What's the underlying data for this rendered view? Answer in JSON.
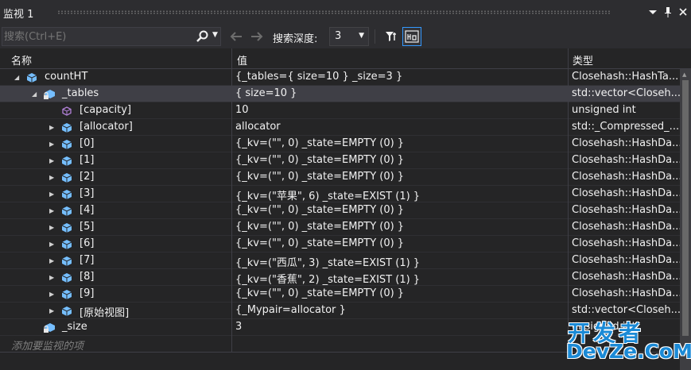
{
  "window": {
    "title": "监视 1",
    "buttons": [
      "chevron-down-icon",
      "pin-icon",
      "close-icon"
    ]
  },
  "toolbar": {
    "search_placeholder": "搜索(Ctrl+E)",
    "search_depth_label": "搜索深度:",
    "search_depth_value": "3"
  },
  "columns": {
    "name": "名称",
    "value": "值",
    "type": "类型"
  },
  "rows": [
    {
      "name": "countHT",
      "value": "{_tables={ size=10 } _size=3 }",
      "type": "Closehash::HashTa...",
      "level": 0,
      "expanded": true,
      "icon": "object-icon"
    },
    {
      "name": "_tables",
      "value": "{ size=10 }",
      "type": "std::vector<Closeh...",
      "level": 1,
      "expanded": true,
      "icon": "field-lock-icon",
      "selected": true
    },
    {
      "name": "[capacity]",
      "value": "10",
      "type": "unsigned int",
      "level": 2,
      "expanded": null,
      "icon": "property-icon"
    },
    {
      "name": "[allocator]",
      "value": "allocator",
      "type": "std::_Compressed_...",
      "level": 2,
      "expanded": false,
      "icon": "object-icon"
    },
    {
      "name": "[0]",
      "value": "{_kv=(\"\", 0) _state=EMPTY (0) }",
      "type": "Closehash::HashDa...",
      "level": 2,
      "expanded": false,
      "icon": "object-icon"
    },
    {
      "name": "[1]",
      "value": "{_kv=(\"\", 0) _state=EMPTY (0) }",
      "type": "Closehash::HashDa...",
      "level": 2,
      "expanded": false,
      "icon": "object-icon"
    },
    {
      "name": "[2]",
      "value": "{_kv=(\"\", 0) _state=EMPTY (0) }",
      "type": "Closehash::HashDa...",
      "level": 2,
      "expanded": false,
      "icon": "object-icon"
    },
    {
      "name": "[3]",
      "value": "{_kv=(\"苹果\", 6) _state=EXIST (1) }",
      "type": "Closehash::HashDa...",
      "level": 2,
      "expanded": false,
      "icon": "object-icon"
    },
    {
      "name": "[4]",
      "value": "{_kv=(\"\", 0) _state=EMPTY (0) }",
      "type": "Closehash::HashDa...",
      "level": 2,
      "expanded": false,
      "icon": "object-icon"
    },
    {
      "name": "[5]",
      "value": "{_kv=(\"\", 0) _state=EMPTY (0) }",
      "type": "Closehash::HashDa...",
      "level": 2,
      "expanded": false,
      "icon": "object-icon"
    },
    {
      "name": "[6]",
      "value": "{_kv=(\"\", 0) _state=EMPTY (0) }",
      "type": "Closehash::HashDa...",
      "level": 2,
      "expanded": false,
      "icon": "object-icon"
    },
    {
      "name": "[7]",
      "value": "{_kv=(\"西瓜\", 3) _state=EXIST (1) }",
      "type": "Closehash::HashDa...",
      "level": 2,
      "expanded": false,
      "icon": "object-icon"
    },
    {
      "name": "[8]",
      "value": "{_kv=(\"香蕉\", 2) _state=EXIST (1) }",
      "type": "Closehash::HashDa...",
      "level": 2,
      "expanded": false,
      "icon": "object-icon"
    },
    {
      "name": "[9]",
      "value": "{_kv=(\"\", 0) _state=EMPTY (0) }",
      "type": "Closehash::HashDa...",
      "level": 2,
      "expanded": false,
      "icon": "object-icon"
    },
    {
      "name": "[原始视图]",
      "value": "{_Mypair=allocator }",
      "type": "std::vector<Closeh...",
      "level": 2,
      "expanded": false,
      "icon": "object-icon"
    },
    {
      "name": "_size",
      "value": "3",
      "type": "unsigned int",
      "level": 1,
      "expanded": null,
      "icon": "field-lock-icon"
    }
  ],
  "add_watch_placeholder": "添加要监视的项",
  "watermark": {
    "line1": "开发者",
    "line2": "DevZe.CoM"
  },
  "colors": {
    "background": "#252526",
    "selection": "#3f3f46",
    "object_icon": "#75beff",
    "property_icon": "#b180d7",
    "accent": "#3399ff"
  }
}
